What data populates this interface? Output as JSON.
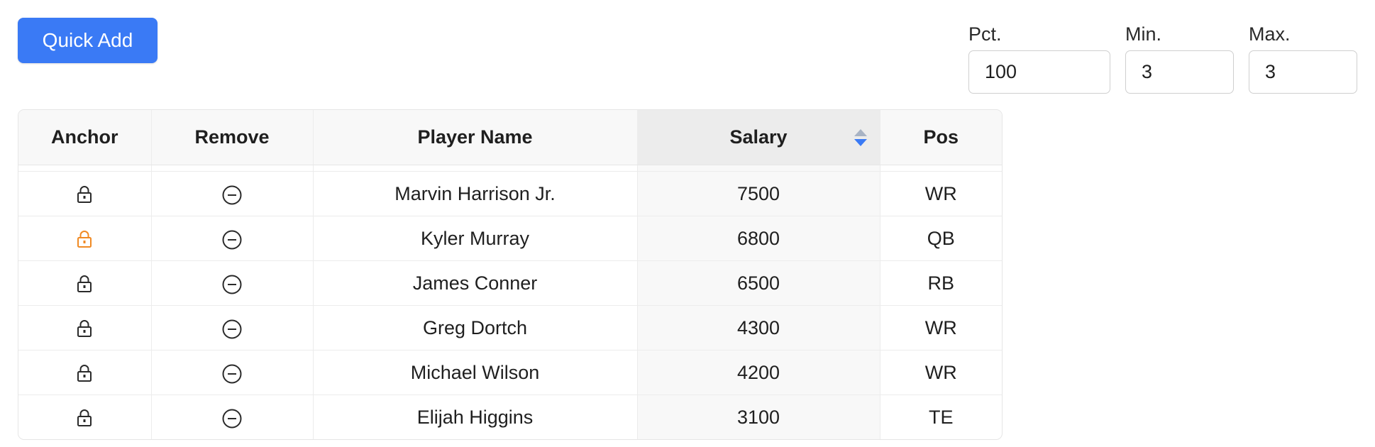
{
  "toolbar": {
    "quick_add_label": "Quick Add"
  },
  "exposure": {
    "pct_label": "Pct.",
    "pct_value": "100",
    "min_label": "Min.",
    "min_value": "3",
    "max_label": "Max.",
    "max_value": "3"
  },
  "table": {
    "headers": {
      "anchor": "Anchor",
      "remove": "Remove",
      "player_name": "Player Name",
      "salary": "Salary",
      "pos": "Pos"
    },
    "sorted_column": "Salary",
    "sort_direction": "descending",
    "rows": [
      {
        "anchor_icon": "lock-icon",
        "anchored": false,
        "remove_icon": "minus-circle-icon",
        "player_name": "Marvin Harrison Jr.",
        "salary": "7500",
        "pos": "WR"
      },
      {
        "anchor_icon": "lock-icon",
        "anchored": true,
        "remove_icon": "minus-circle-icon",
        "player_name": "Kyler Murray",
        "salary": "6800",
        "pos": "QB"
      },
      {
        "anchor_icon": "lock-icon",
        "anchored": false,
        "remove_icon": "minus-circle-icon",
        "player_name": "James Conner",
        "salary": "6500",
        "pos": "RB"
      },
      {
        "anchor_icon": "lock-icon",
        "anchored": false,
        "remove_icon": "minus-circle-icon",
        "player_name": "Greg Dortch",
        "salary": "4300",
        "pos": "WR"
      },
      {
        "anchor_icon": "lock-icon",
        "anchored": false,
        "remove_icon": "minus-circle-icon",
        "player_name": "Michael Wilson",
        "salary": "4200",
        "pos": "WR"
      },
      {
        "anchor_icon": "lock-icon",
        "anchored": false,
        "remove_icon": "minus-circle-icon",
        "player_name": "Elijah Higgins",
        "salary": "3100",
        "pos": "TE"
      }
    ]
  },
  "colors": {
    "accent": "#3a7af5",
    "anchored_lock": "#f08a24",
    "default_icon": "#2a2a2a"
  }
}
